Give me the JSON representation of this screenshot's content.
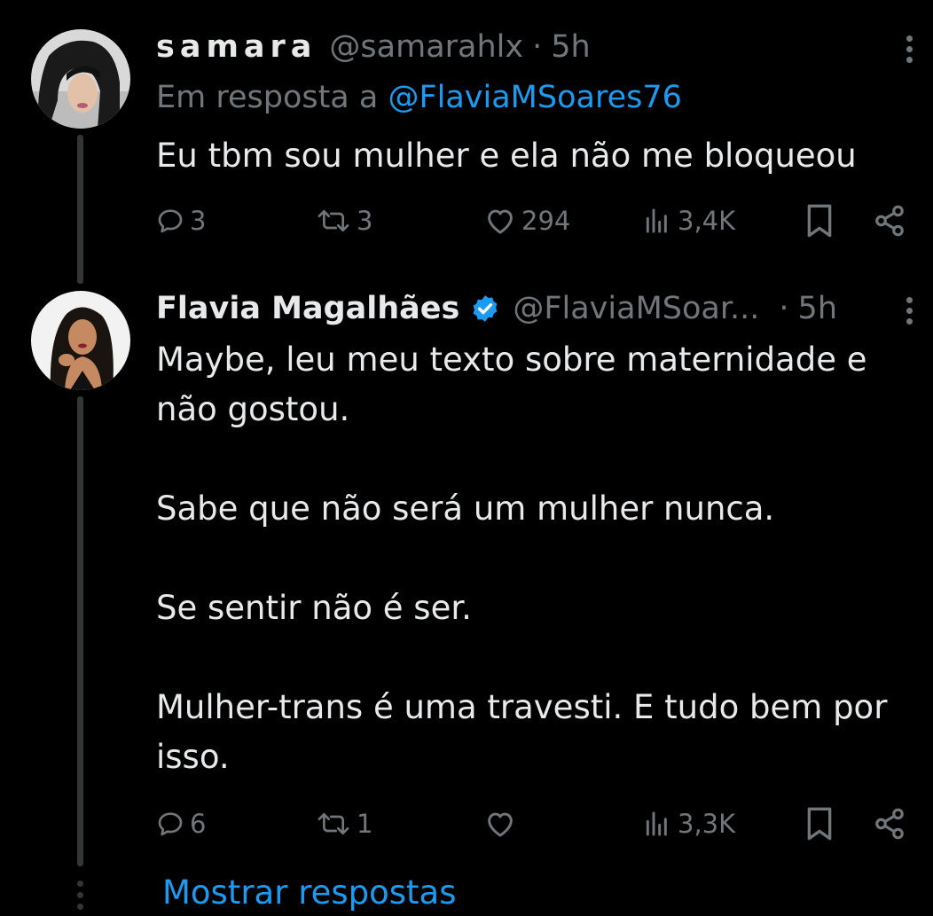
{
  "tweets": [
    {
      "name": "samara",
      "handle": "@samarahlx",
      "time": "5h",
      "dot": "·",
      "reply_prefix": "Em resposta a",
      "reply_handle": "@FlaviaMSoares76",
      "text": [
        "Eu tbm sou mulher e ela não me bloqueou"
      ],
      "stats": {
        "replies": "3",
        "reposts": "3",
        "likes": "294",
        "views": "3,4K"
      },
      "avatar_icon": "user-avatar-photo"
    },
    {
      "name": "Flavia Magalhães",
      "handle": "@FlaviaMSoar...",
      "time": "5h",
      "dot": "·",
      "verified": true,
      "text": [
        "Maybe, leu meu texto sobre maternidade e não gostou.",
        "Sabe que não será um mulher nunca.",
        "Se sentir não é ser.",
        "Mulher-trans é uma travesti. E tudo bem por isso."
      ],
      "stats": {
        "replies": "6",
        "reposts": "1",
        "likes": "",
        "views": "3,3K"
      },
      "avatar_icon": "user-avatar-photo"
    }
  ],
  "show_replies_label": "Mostrar respostas",
  "colors": {
    "background": "#000000",
    "text": "#e7e9ea",
    "muted": "#71767b",
    "accent": "#1d9bf0",
    "thread_line": "#333639"
  },
  "icons": [
    "reply-icon",
    "repost-icon",
    "like-icon",
    "views-icon",
    "bookmark-icon",
    "share-icon",
    "more-icon",
    "verified-badge-icon"
  ]
}
